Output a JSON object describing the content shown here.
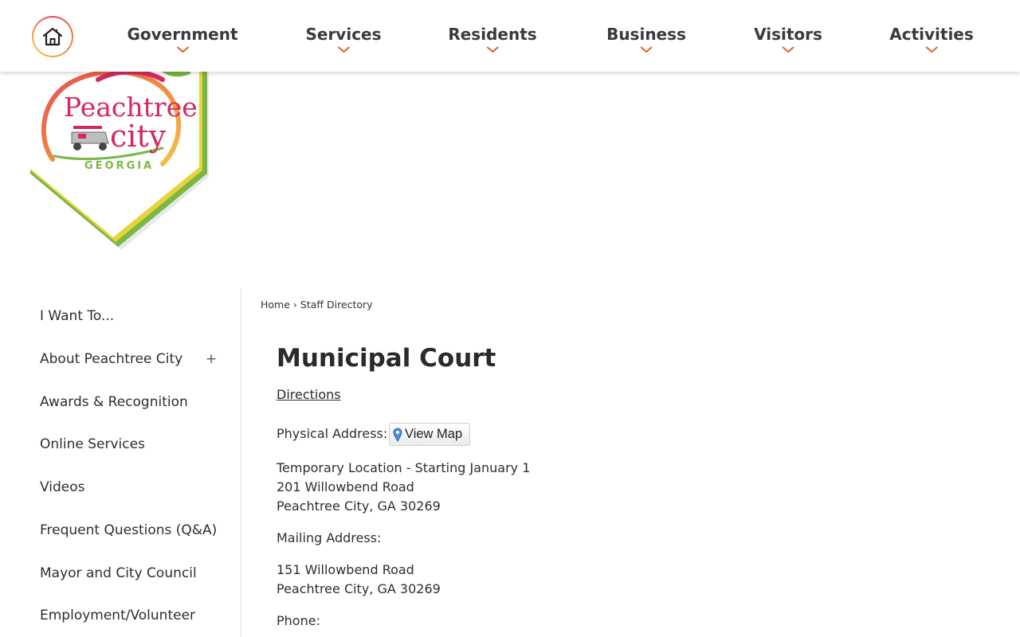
{
  "nav": {
    "home_label": "Home",
    "items": [
      {
        "label": "Government"
      },
      {
        "label": "Services"
      },
      {
        "label": "Residents"
      },
      {
        "label": "Business"
      },
      {
        "label": "Visitors"
      },
      {
        "label": "Activities"
      }
    ]
  },
  "logo": {
    "line1": "Peachtree",
    "line2": "city",
    "line3": "GEORGIA"
  },
  "sidebar": {
    "items": [
      {
        "label": "I Want To..."
      },
      {
        "label": "About Peachtree City",
        "expand": "+"
      },
      {
        "label": "Awards & Recognition"
      },
      {
        "label": "Online Services"
      },
      {
        "label": "Videos"
      },
      {
        "label": "Frequent Questions (Q&A)"
      },
      {
        "label": "Mayor and City Council"
      },
      {
        "label": "Employment/Volunteer"
      }
    ]
  },
  "breadcrumb": {
    "home": "Home",
    "separator": "›",
    "current": "Staff Directory"
  },
  "main": {
    "title": "Municipal Court",
    "directions_link": "Directions",
    "physical_label": "Physical Address:",
    "view_map_label": "View Map",
    "physical_lines": [
      "Temporary Location - Starting January 1",
      "201 Willowbend Road",
      "Peachtree City, GA 30269"
    ],
    "mailing_label": "Mailing Address:",
    "mailing_lines": [
      "151 Willowbend Road",
      "Peachtree City, GA 30269"
    ],
    "phone_label": "Phone:"
  },
  "colors": {
    "accent_orange": "#e0652a",
    "logo_pink": "#d6285f",
    "logo_orange": "#f08a3c",
    "logo_green": "#7ab744",
    "logo_yellow": "#e8d23a"
  },
  "icons": {
    "home": "house-icon",
    "chevron": "chevron-down-icon",
    "map_pin": "map-pin-icon"
  }
}
